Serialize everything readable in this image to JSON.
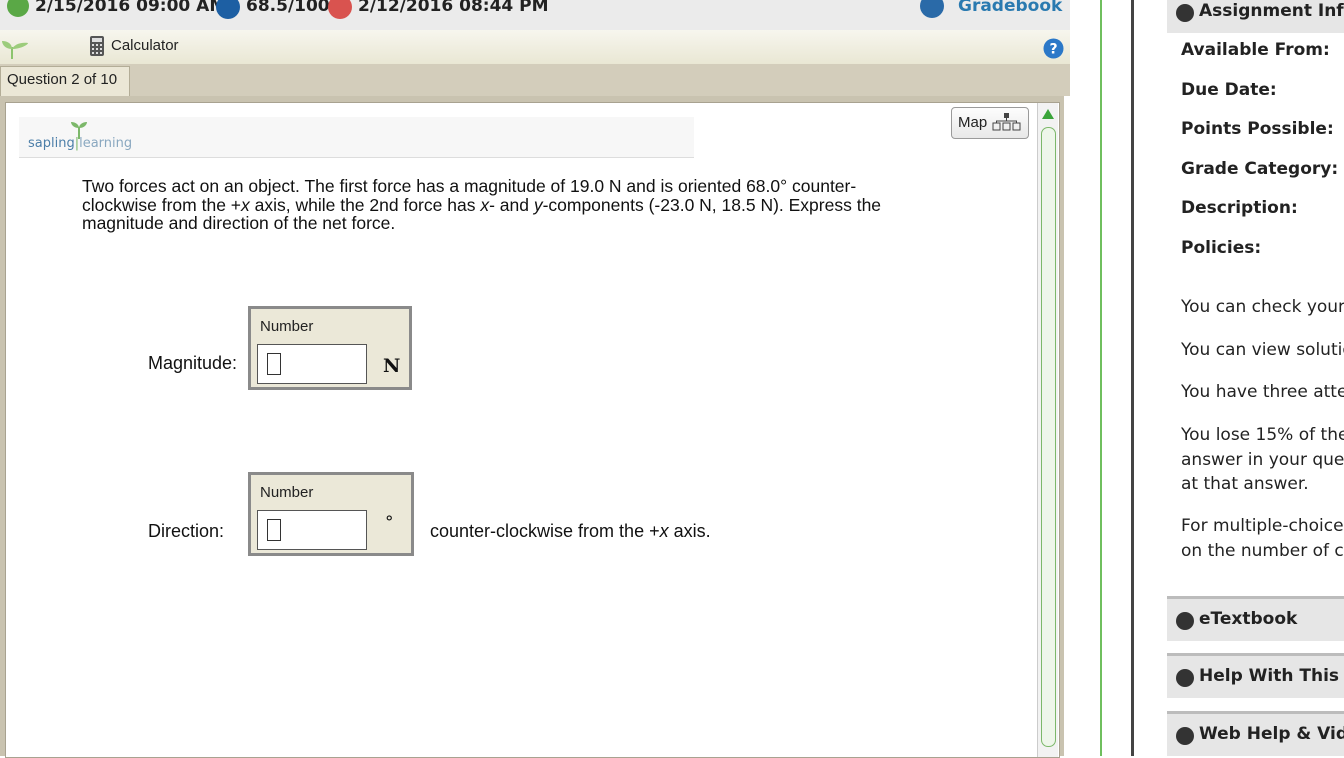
{
  "status_bar": {
    "due_date": "2/15/2016 09:00 AM",
    "score": "68.5/100",
    "last_date": "2/12/2016 08:44 PM",
    "gradebook_label": "Gradebook"
  },
  "toolbar": {
    "calculator_label": "Calculator"
  },
  "tabs": {
    "question_tab": "Question 2 of 10"
  },
  "content": {
    "logo_text_left": "sapling",
    "logo_text_right": "learning",
    "map_label": "Map",
    "question_text_line1": "Two forces act on an object.  The first force has a magnitude of 19.0 N and is oriented 68.0° counter-",
    "question_text_line2_prefix": "clockwise from the +",
    "question_text_line2_mid": " axis, while the 2nd force has ",
    "question_text_line2_and": "- and ",
    "question_text_line2_suffix": "-components (-23.0 N, 18.5 N).  Express the",
    "question_text_line3": "magnitude and direction of the net force.",
    "var_x": "x",
    "var_y": "y"
  },
  "answers": {
    "magnitude": {
      "label": "Magnitude:",
      "caption": "Number",
      "value": "",
      "unit": "N"
    },
    "direction": {
      "label": "Direction:",
      "caption": "Number",
      "value": "",
      "unit": "°",
      "suffix_prefix": "counter-clockwise from the +",
      "suffix_var": "x",
      "suffix_end": " axis."
    }
  },
  "right_panel": {
    "header": "Assignment Info",
    "fields": [
      "Available From:",
      "Due Date:",
      "Points Possible:",
      "Grade Category:",
      "Description:",
      "Policies:"
    ],
    "policies": [
      "You can check your",
      "You can view solutio",
      "You have three atte",
      "You lose 15% of the",
      "answer in your que",
      "at that answer.",
      "For multiple-choice",
      "on the number of cl"
    ],
    "sections": [
      "eTextbook",
      "Help With This To",
      "Web Help & Vide"
    ]
  },
  "colors": {
    "accent_green": "#6fbf5e",
    "link_blue": "#2a7ab0",
    "status_green": "#5aa846",
    "status_blue": "#1d5fa3",
    "status_red": "#d9534f"
  },
  "icons": [
    "clock-icon",
    "score-icon",
    "late-icon",
    "gradebook-icon",
    "sprout-icon",
    "calculator-icon",
    "help-icon",
    "map-icon",
    "scroll-up-arrow-icon",
    "collapse-icon",
    "expand-icon"
  ]
}
